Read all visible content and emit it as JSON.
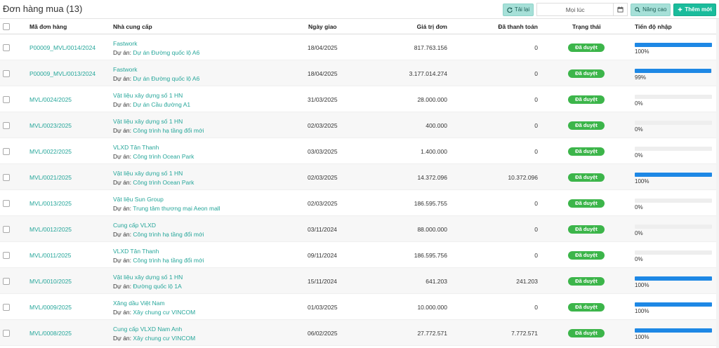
{
  "header": {
    "title": "Đơn hàng mua (13)",
    "reload_label": "Tải lại",
    "date_filter_value": "Mọi lúc",
    "advanced_label": "Nâng cao",
    "add_new_label": "Thêm mới"
  },
  "columns": {
    "order_code": "Mã đơn hàng",
    "supplier": "Nhà cung cấp",
    "delivery_date": "Ngày giao",
    "order_value": "Giá trị đơn",
    "paid": "Đã thanh toán",
    "status": "Trạng thái",
    "import_progress": "Tiến độ nhập"
  },
  "project_prefix": "Dự án:",
  "colors": {
    "link": "#26a69a",
    "status_approved": "#3cb54a",
    "progress": "#1e88e5",
    "accent": "#1abc9c"
  },
  "rows": [
    {
      "code": "P00009_MVL/0014/2024",
      "supplier": "Fastwork",
      "project": "Dự án Đường quốc lộ A6",
      "date": "18/04/2025",
      "value": "817.763.156",
      "paid": "0",
      "status": "Đã duyệt",
      "progress": 100,
      "progress_label": "100%"
    },
    {
      "code": "P00009_MVL/0013/2024",
      "supplier": "Fastwork",
      "project": "Dự án Đường quốc lộ A6",
      "date": "18/04/2025",
      "value": "3.177.014.274",
      "paid": "0",
      "status": "Đã duyệt",
      "progress": 99,
      "progress_label": "99%"
    },
    {
      "code": "MVL/0024/2025",
      "supplier": "Vật liệu xây dựng số 1 HN",
      "project": "Dự án Cầu đường A1",
      "date": "31/03/2025",
      "value": "28.000.000",
      "paid": "0",
      "status": "Đã duyệt",
      "progress": 0,
      "progress_label": "0%"
    },
    {
      "code": "MVL/0023/2025",
      "supplier": "Vật liệu xây dựng số 1 HN",
      "project": "Công trình hạ tầng đổi mới",
      "date": "02/03/2025",
      "value": "400.000",
      "paid": "0",
      "status": "Đã duyệt",
      "progress": 0,
      "progress_label": "0%"
    },
    {
      "code": "MVL/0022/2025",
      "supplier": "VLXD Tân Thanh",
      "project": "Công trình Ocean Park",
      "date": "03/03/2025",
      "value": "1.400.000",
      "paid": "0",
      "status": "Đã duyệt",
      "progress": 0,
      "progress_label": "0%"
    },
    {
      "code": "MVL/0021/2025",
      "supplier": "Vật liệu xây dựng số 1 HN",
      "project": "Công trình Ocean Park",
      "date": "02/03/2025",
      "value": "14.372.096",
      "paid": "10.372.096",
      "status": "Đã duyệt",
      "progress": 100,
      "progress_label": "100%"
    },
    {
      "code": "MVL/0013/2025",
      "supplier": "Vật liệu Sun Group",
      "project": "Trung tâm thương mại Aeon mall",
      "date": "02/03/2025",
      "value": "186.595.755",
      "paid": "0",
      "status": "Đã duyệt",
      "progress": 0,
      "progress_label": "0%"
    },
    {
      "code": "MVL/0012/2025",
      "supplier": "Cung cấp VLXD",
      "project": "Công trình hạ tầng đổi mới",
      "date": "03/11/2024",
      "value": "88.000.000",
      "paid": "0",
      "status": "Đã duyệt",
      "progress": 0,
      "progress_label": "0%"
    },
    {
      "code": "MVL/0011/2025",
      "supplier": "VLXD Tân Thanh",
      "project": "Công trình hạ tầng đổi mới",
      "date": "09/11/2024",
      "value": "186.595.756",
      "paid": "0",
      "status": "Đã duyệt",
      "progress": 0,
      "progress_label": "0%"
    },
    {
      "code": "MVL/0010/2025",
      "supplier": "Vật liệu xây dựng số 1 HN",
      "project": "Đường quốc lộ 1A",
      "date": "15/11/2024",
      "value": "641.203",
      "paid": "241.203",
      "status": "Đã duyệt",
      "progress": 100,
      "progress_label": "100%"
    },
    {
      "code": "MVL/0009/2025",
      "supplier": "Xăng dầu Việt Nam",
      "project": "Xây chung cư VINCOM",
      "date": "01/03/2025",
      "value": "10.000.000",
      "paid": "0",
      "status": "Đã duyệt",
      "progress": 100,
      "progress_label": "100%"
    },
    {
      "code": "MVL/0008/2025",
      "supplier": "Cung cấp VLXD Nam Anh",
      "project": "Xây chung cư VINCOM",
      "date": "06/02/2025",
      "value": "27.772.571",
      "paid": "7.772.571",
      "status": "Đã duyệt",
      "progress": 100,
      "progress_label": "100%"
    }
  ]
}
